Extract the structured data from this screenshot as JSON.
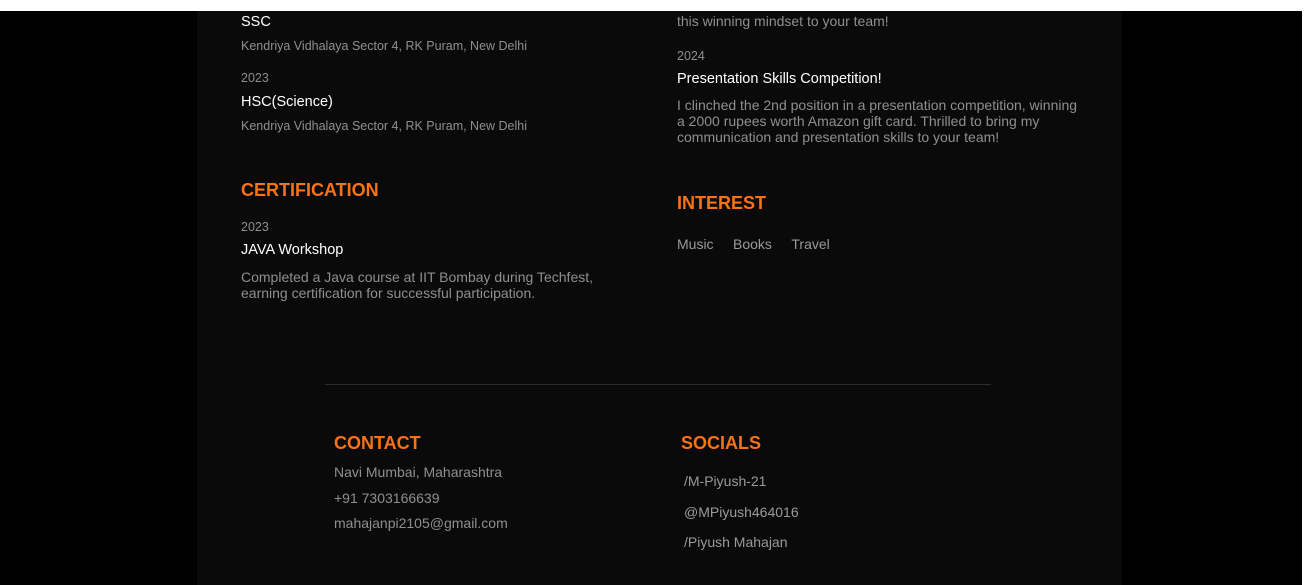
{
  "education": {
    "ssc": {
      "title": "SSC",
      "school": "Kendriya Vidhalaya Sector 4, RK Puram, New Delhi"
    },
    "hsc": {
      "year": "2023",
      "title": "HSC(Science)",
      "school": "Kendriya Vidhalaya Sector 4, RK Puram, New Delhi"
    }
  },
  "achievements": {
    "partial_desc": "this winning mindset to your team!",
    "items": [
      {
        "year": "2024",
        "title": "Presentation Skills Competition!",
        "desc": "I clinched the 2nd position in a presentation competition, winning a 2000 rupees worth Amazon gift card. Thrilled to bring my communication and presentation skills to your team!"
      }
    ]
  },
  "certification": {
    "heading": "CERTIFICATION",
    "items": [
      {
        "year": "2023",
        "title": "JAVA Workshop",
        "desc": "Completed a Java course at IIT Bombay during Techfest, earning certification for successful participation."
      }
    ]
  },
  "interest": {
    "heading": "INTEREST",
    "tags": [
      "Music",
      "Books",
      "Travel"
    ]
  },
  "footer": {
    "contact": {
      "heading": "CONTACT",
      "location": "Navi Mumbai, Maharashtra",
      "phone": "+91 7303166639",
      "email": "mahajanpi2105@gmail.com"
    },
    "socials": {
      "heading": "SOCIALS",
      "links": [
        "/M-Piyush-21",
        "@MPiyush464016",
        "/Piyush Mahajan"
      ]
    }
  },
  "colors": {
    "accent": "#f97316",
    "page_bg": "#0a0a0a",
    "outer_bg": "#000000",
    "muted_text": "#8f8f8f"
  }
}
